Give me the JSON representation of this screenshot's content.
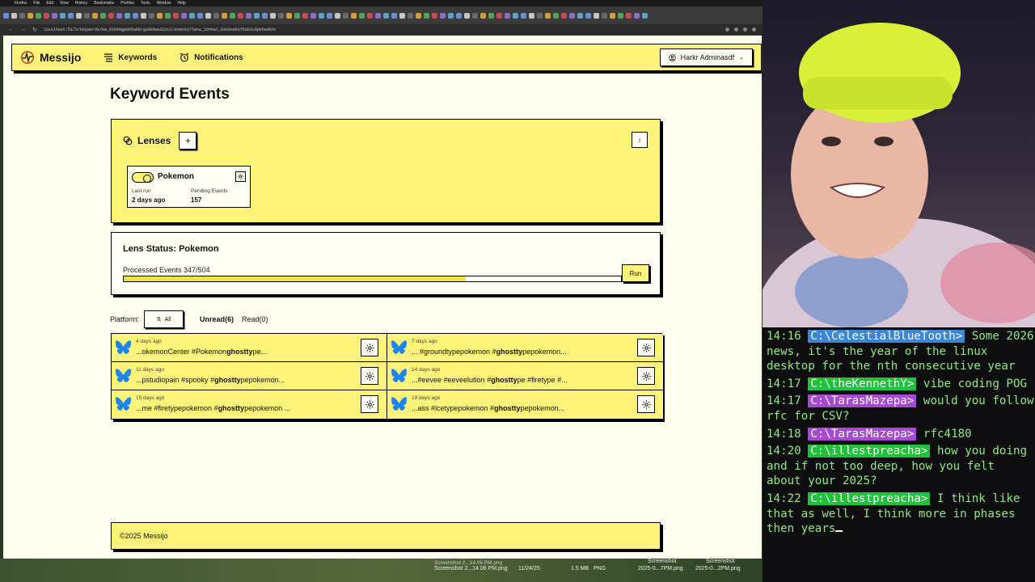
{
  "browser": {
    "menubar": [
      "Firefox",
      "File",
      "Edit",
      "View",
      "History",
      "Bookmarks",
      "Profiles",
      "Tools",
      "Window",
      "Help"
    ],
    "url": "localhost:5173/keywords/kw_01k84gp065a6brgz084ws52yc1/events?lens_id=kwl_01k8seb1f6ab2c0pkba9khr"
  },
  "app": {
    "brand": "Messijo",
    "nav": {
      "keywords": "Keywords",
      "notifications": "Notifications"
    },
    "user": "Harkr Adminasdf",
    "page_title": "Keyword Events",
    "lenses": {
      "title": "Lenses",
      "add_label": "+",
      "items": [
        {
          "name": "Pokemon",
          "enabled": true,
          "last_run_label": "Last run",
          "last_run": "2 days ago",
          "pending_label": "Pending Events",
          "pending": "157"
        }
      ]
    },
    "status": {
      "title": "Lens Status: Pokemon",
      "processed_text": "Processed Events 347/504",
      "processed": 347,
      "total": 504,
      "run_label": "Run"
    },
    "filters": {
      "platform_label": "Platform:",
      "platform_value": "All",
      "unread_label": "Unread(6)",
      "read_label": "Read(0)"
    },
    "events": [
      {
        "age": "4 days ago",
        "pre": "...okemonCenter #Pokemon",
        "bold": "ghostty",
        "post": "pe..."
      },
      {
        "age": "7 days ago",
        "pre": "... #groundtypepokemon #",
        "bold": "ghostty",
        "post": "pepokemon..."
      },
      {
        "age": "11 days ago",
        "pre": "...pstudiopain #spooky #",
        "bold": "ghostty",
        "post": "pepokemon..."
      },
      {
        "age": "14 days ago",
        "pre": "...#eevee #eeveelution #",
        "bold": "ghostty",
        "post": "pe #firetype #..."
      },
      {
        "age": "15 days ago",
        "pre": "...me #firetypepokemon #",
        "bold": "ghostty",
        "post": "pepokemon ..."
      },
      {
        "age": "19 days ago",
        "pre": "...ass #icetypepokemon #",
        "bold": "ghostty",
        "post": "pepokemon..."
      }
    ],
    "footer": "©2025 Messijo"
  },
  "taskbar": {
    "file_name": "Screenshot 2...14.06 PM.png",
    "file_date": "11/24/25",
    "file_size": "1.5 MB",
    "file_type": "PNG",
    "thumbs": [
      "Screenshot",
      "Screenshot"
    ],
    "thumb_names": [
      "2025-0...7PM.png",
      "2025-0...2PM.png"
    ]
  },
  "chat": [
    {
      "time": "14:16",
      "user": "C:\\CelestialBlueTooth>",
      "color": "#3c86d6",
      "text": " Some 2026 news, it's the year of the linux desktop for the nth consecutive year"
    },
    {
      "time": "14:17",
      "user": "C:\\theKennethY>",
      "color": "#1fc23a",
      "text": " vibe coding POG"
    },
    {
      "time": "14:17",
      "user": "C:\\TarasMazepa>",
      "color": "#a64ad0",
      "text": " would you follow rfc for CSV?"
    },
    {
      "time": "14:18",
      "user": "C:\\TarasMazepa>",
      "color": "#a64ad0",
      "text": " rfc4180"
    },
    {
      "time": "14:20",
      "user": "C:\\illestpreacha>",
      "color": "#1fc23a",
      "text": " how you doing and if not too deep, how you felt about your 2025?"
    },
    {
      "time": "14:22",
      "user": "C:\\illestpreacha>",
      "color": "#1fc23a",
      "text": " I think like that as well, I think more in phases then years"
    }
  ]
}
